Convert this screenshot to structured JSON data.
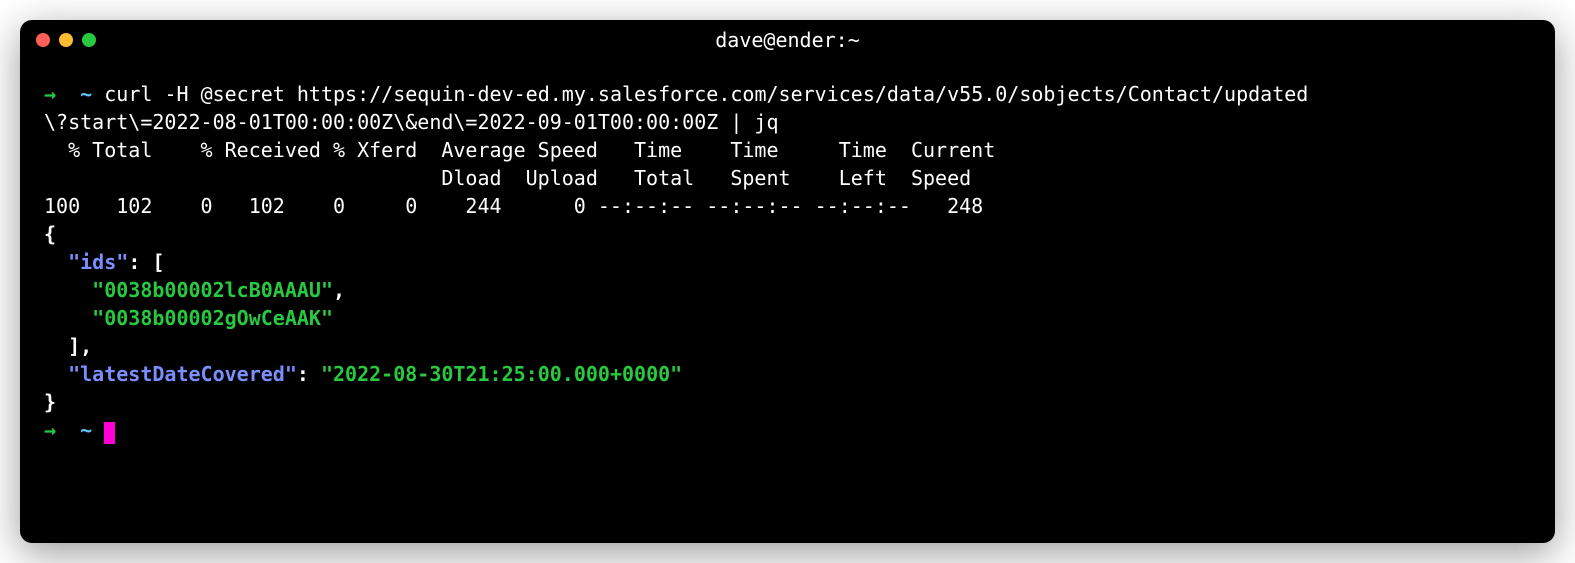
{
  "titlebar": {
    "title": "dave@ender:~"
  },
  "prompt": {
    "arrow": "→",
    "tilde": "~"
  },
  "command": {
    "line1": "curl -H @secret https://sequin-dev-ed.my.salesforce.com/services/data/v55.0/sobjects/Contact/updated",
    "line2": "\\?start\\=2022-08-01T00:00:00Z\\&end\\=2022-09-01T00:00:00Z | jq"
  },
  "curl_output": {
    "header1": "  % Total    % Received % Xferd  Average Speed   Time    Time     Time  Current",
    "header2": "                                 Dload  Upload   Total   Spent    Left  Speed",
    "stats": "100   102    0   102    0     0    244      0 --:--:-- --:--:-- --:--:--   248"
  },
  "json": {
    "open": "{",
    "ids_key": "\"ids\"",
    "ids_open": ": [",
    "id1": "\"0038b00002lcB0AAAU\"",
    "comma": ",",
    "id2": "\"0038b00002gOwCeAAK\"",
    "ids_close": "],",
    "latest_key": "\"latestDateCovered\"",
    "latest_colon": ": ",
    "latest_val": "\"2022-08-30T21:25:00.000+0000\"",
    "close": "}"
  }
}
